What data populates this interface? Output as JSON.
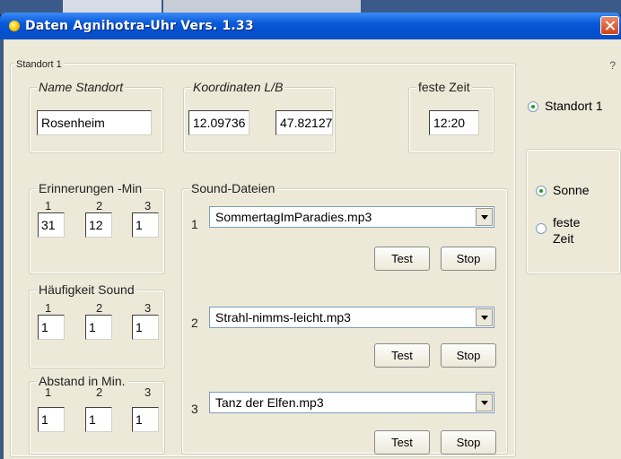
{
  "window": {
    "title": "Daten  Agnihotra-Uhr Vers. 1.33",
    "help": "?"
  },
  "background": {
    "partial_text": "Rosenheim"
  },
  "standort_group": {
    "label": "Standort 1",
    "name_standort": {
      "label": "Name Standort",
      "value": "Rosenheim"
    },
    "koordinaten": {
      "label": "Koordinaten L/B",
      "l_value": "12.09736",
      "b_value": "47.82127"
    },
    "feste_zeit": {
      "label": "feste Zeit",
      "value": "12:20"
    },
    "erinnerungen": {
      "label": "Erinnerungen -Min",
      "cols": [
        "1",
        "2",
        "3"
      ],
      "values": [
        "31",
        "12",
        "1"
      ]
    },
    "haeufigkeit": {
      "label": "Häufigkeit Sound",
      "cols": [
        "1",
        "2",
        "3"
      ],
      "values": [
        "1",
        "1",
        "1"
      ]
    },
    "abstand": {
      "label": "Abstand in Min.",
      "cols": [
        "1",
        "2",
        "3"
      ],
      "values": [
        "1",
        "1",
        "1"
      ]
    },
    "sound": {
      "label": "Sound-Dateien",
      "items": [
        {
          "index": "1",
          "file": "SommertagImParadies.mp3",
          "test": "Test",
          "stop": "Stop"
        },
        {
          "index": "2",
          "file": "Strahl-nimms-leicht.mp3",
          "test": "Test",
          "stop": "Stop"
        },
        {
          "index": "3",
          "file": "Tanz der Elfen.mp3",
          "test": "Test",
          "stop": "Stop"
        }
      ]
    }
  },
  "right_panel": {
    "standort_radio": {
      "label": "Standort 1",
      "checked": true
    },
    "sonne_radio": {
      "label": "Sonne",
      "checked": true
    },
    "feste_zeit_radio": {
      "label_line1": "feste",
      "label_line2": "Zeit",
      "checked": false
    }
  }
}
